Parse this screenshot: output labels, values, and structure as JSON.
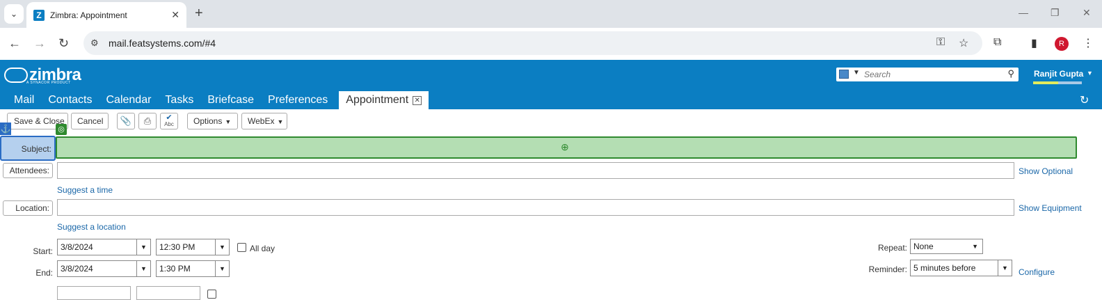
{
  "browser": {
    "tab_title": "Zimbra: Appointment",
    "favicon_letter": "Z",
    "url": "mail.featsystems.com/#4",
    "profile_initial": "R"
  },
  "zimbra": {
    "logo_text": "zimbra",
    "logo_sub": "A SYNACOR PRODUCT",
    "search_placeholder": "Search",
    "user_name": "Ranjit Gupta",
    "tabs": [
      "Mail",
      "Contacts",
      "Calendar",
      "Tasks",
      "Briefcase",
      "Preferences"
    ],
    "active_tab": "Appointment",
    "brand_color": "#0b7ec2"
  },
  "toolbar": {
    "save_close": "Save & Close",
    "cancel": "Cancel",
    "options": "Options",
    "webex": "WebEx",
    "spell_label": "Abc"
  },
  "form": {
    "subject_label": "Subject:",
    "subject_value": "",
    "attendees_label": "Attendees:",
    "show_optional": "Show Optional",
    "suggest_time": "Suggest a time",
    "location_label": "Location:",
    "show_equipment": "Show Equipment",
    "suggest_location": "Suggest a location",
    "start_label": "Start:",
    "start_date": "3/8/2024",
    "start_time": "12:30 PM",
    "all_day": "All day",
    "end_label": "End:",
    "end_date": "3/8/2024",
    "end_time": "1:30 PM",
    "repeat_label": "Repeat:",
    "repeat_value": "None",
    "reminder_label": "Reminder:",
    "reminder_value": "5 minutes before",
    "configure": "Configure"
  }
}
